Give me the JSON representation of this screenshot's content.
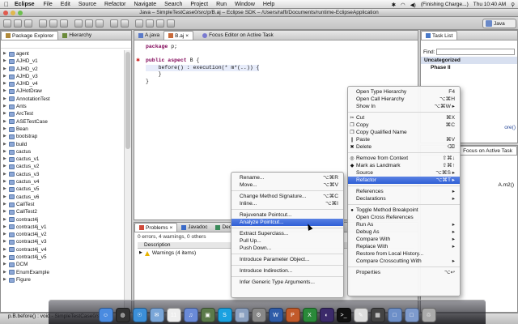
{
  "menubar": {
    "app": "Eclipse",
    "items": [
      "File",
      "Edit",
      "Source",
      "Refactor",
      "Navigate",
      "Search",
      "Project",
      "Run",
      "Window",
      "Help"
    ],
    "battery": "(Finishing Charge...)",
    "clock": "Thu 10:40 AM"
  },
  "window": {
    "title": "Java – SimpleTestCase0/src/p/B.aj – Eclipse SDK – /Users/raffi/Documents/runtime-EclipseApplication"
  },
  "perspective": {
    "label": "Java"
  },
  "package_explorer": {
    "tabs": [
      "Package Explorer",
      "Hierarchy"
    ],
    "items": [
      "agent",
      "AJHD_v1",
      "AJHD_v2",
      "AJHD_v3",
      "AJHD_v4",
      "AJHotDraw",
      "AnnotationTest",
      "Ants",
      "ArcTest",
      "ASETestCase",
      "Bean",
      "bootstrap",
      "build",
      "cactus",
      "cactus_v1",
      "cactus_v2",
      "cactus_v3",
      "cactus_v4",
      "cactus_v5",
      "cactus_v6",
      "CallTest",
      "CallTest2",
      "contract4j",
      "contract4j_v1",
      "contract4j_v2",
      "contract4j_v3",
      "contract4j_v4",
      "contract4j_v5",
      "DCM",
      "EnumExample",
      "Figure"
    ]
  },
  "editor": {
    "tabs": [
      "A.java",
      "B.aj"
    ],
    "focus_label": "Focus Editor on Active Task",
    "code_lines": [
      {
        "kw": "package",
        "rest": " p;"
      },
      {
        "kw": "",
        "rest": ""
      },
      {
        "kw": "public aspect",
        "rest": " B {"
      },
      {
        "kw": "",
        "rest": "    before() : execution(* m*(..)) {"
      },
      {
        "kw": "",
        "rest": "    }"
      },
      {
        "kw": "",
        "rest": "}"
      }
    ]
  },
  "problems": {
    "tabs": [
      "Problems",
      "Javadoc",
      "Declar"
    ],
    "summary": "0 errors, 4 warnings, 0 others",
    "column": "Description",
    "row": "Warnings (4 items)"
  },
  "task_list": {
    "title": "Task List",
    "find_label": "Find:",
    "category": "Uncategorized",
    "task": "Phase II"
  },
  "outline": {
    "tab": "Focus on Active Task",
    "fragment": "ces",
    "partial1": "ore()",
    "partial2": "A.m2()"
  },
  "context_menu": {
    "items": [
      {
        "label": "Open Type Hierarchy",
        "shortcut": "F4"
      },
      {
        "label": "Open Call Hierarchy",
        "shortcut": "⌥⌘H"
      },
      {
        "label": "Show In",
        "shortcut": "⌥⌘W ▸"
      },
      {
        "sep": true
      },
      {
        "label": "Cut",
        "shortcut": "⌘X",
        "icon": "✂"
      },
      {
        "label": "Copy",
        "shortcut": "⌘C",
        "icon": "❐"
      },
      {
        "label": "Copy Qualified Name",
        "shortcut": "",
        "icon": "❐"
      },
      {
        "label": "Paste",
        "shortcut": "⌘V",
        "icon": "❙"
      },
      {
        "label": "Delete",
        "shortcut": "⌫",
        "icon": "✖"
      },
      {
        "sep": true
      },
      {
        "label": "Remove from Context",
        "shortcut": "⇧⌘↓",
        "icon": "◎"
      },
      {
        "label": "Mark as Landmark",
        "shortcut": "⇧⌘↑",
        "icon": "◆"
      },
      {
        "label": "Source",
        "shortcut": "⌥⌘S ▸"
      },
      {
        "label": "Refactor",
        "shortcut": "⌥⌘T ▸",
        "hi": true
      },
      {
        "sep": true
      },
      {
        "label": "References",
        "shortcut": "▸"
      },
      {
        "label": "Declarations",
        "shortcut": "▸"
      },
      {
        "sep": true
      },
      {
        "label": "Toggle Method Breakpoint",
        "shortcut": "",
        "icon": "●"
      },
      {
        "label": "Open Cross References",
        "shortcut": ""
      },
      {
        "label": "Run As",
        "shortcut": "▸"
      },
      {
        "label": "Debug As",
        "shortcut": "▸"
      },
      {
        "label": "Compare With",
        "shortcut": "▸"
      },
      {
        "label": "Replace With",
        "shortcut": "▸"
      },
      {
        "label": "Restore from Local History...",
        "shortcut": ""
      },
      {
        "label": "Compare Crosscutting With",
        "shortcut": "▸"
      },
      {
        "sep": true
      },
      {
        "label": "Properties",
        "shortcut": "⌥↩"
      }
    ]
  },
  "refactor_menu": {
    "items": [
      {
        "label": "Rename...",
        "shortcut": "⌥⌘R"
      },
      {
        "label": "Move...",
        "shortcut": "⌥⌘V"
      },
      {
        "sep": true
      },
      {
        "label": "Change Method Signature...",
        "shortcut": "⌥⌘C"
      },
      {
        "label": "Inline...",
        "shortcut": "⌥⌘I"
      },
      {
        "sep": true
      },
      {
        "label": "Rejuvenate Pointcut...",
        "shortcut": ""
      },
      {
        "label": "Analyze Pointcut...",
        "shortcut": "",
        "hi": true
      },
      {
        "sep": true
      },
      {
        "label": "Extract Superclass...",
        "shortcut": ""
      },
      {
        "label": "Pull Up...",
        "shortcut": ""
      },
      {
        "label": "Push Down...",
        "shortcut": ""
      },
      {
        "sep": true
      },
      {
        "label": "Introduce Parameter Object...",
        "shortcut": ""
      },
      {
        "sep": true
      },
      {
        "label": "Introduce Indirection...",
        "shortcut": ""
      },
      {
        "sep": true
      },
      {
        "label": "Infer Generic Type Arguments...",
        "shortcut": ""
      }
    ]
  },
  "status": {
    "text": "p.B.before() : void - SimpleTestCase0/src"
  },
  "dock": {
    "icons": [
      {
        "name": "finder-icon",
        "color": "#4a8be0",
        "glyph": "☺"
      },
      {
        "name": "dashboard-icon",
        "color": "#333",
        "glyph": "◍"
      },
      {
        "name": "safari-icon",
        "color": "#3c8fd8",
        "glyph": "☉"
      },
      {
        "name": "mail-icon",
        "color": "#7aa6d8",
        "glyph": "✉"
      },
      {
        "name": "ical-icon",
        "color": "#eee",
        "glyph": "11"
      },
      {
        "name": "itunes-icon",
        "color": "#6a8ad8",
        "glyph": "♫"
      },
      {
        "name": "iphoto-icon",
        "color": "#5b7a4a",
        "glyph": "▣"
      },
      {
        "name": "skype-icon",
        "color": "#1aa1e0",
        "glyph": "S"
      },
      {
        "name": "preview-icon",
        "color": "#8aa0c0",
        "glyph": "▤"
      },
      {
        "name": "preferences-icon",
        "color": "#888",
        "glyph": "⚙"
      },
      {
        "name": "word-icon",
        "color": "#2f5ca8",
        "glyph": "W"
      },
      {
        "name": "powerpoint-icon",
        "color": "#c25a2a",
        "glyph": "P"
      },
      {
        "name": "excel-icon",
        "color": "#2a8a3a",
        "glyph": "X"
      },
      {
        "name": "eclipse-icon",
        "color": "#3b2a6a",
        "glyph": "◐"
      },
      {
        "name": "terminal-icon",
        "color": "#111",
        "glyph": ">_"
      },
      {
        "name": "textedit-icon",
        "color": "#ddd",
        "glyph": "✎"
      },
      {
        "name": "activity-icon",
        "color": "#444",
        "glyph": "▦"
      },
      {
        "name": "folder-icon",
        "color": "#6d8fc8",
        "glyph": "□"
      },
      {
        "name": "documents-icon",
        "color": "#7e9acc",
        "glyph": "□"
      },
      {
        "name": "trash-icon",
        "color": "#aaa",
        "glyph": "♲"
      }
    ]
  }
}
